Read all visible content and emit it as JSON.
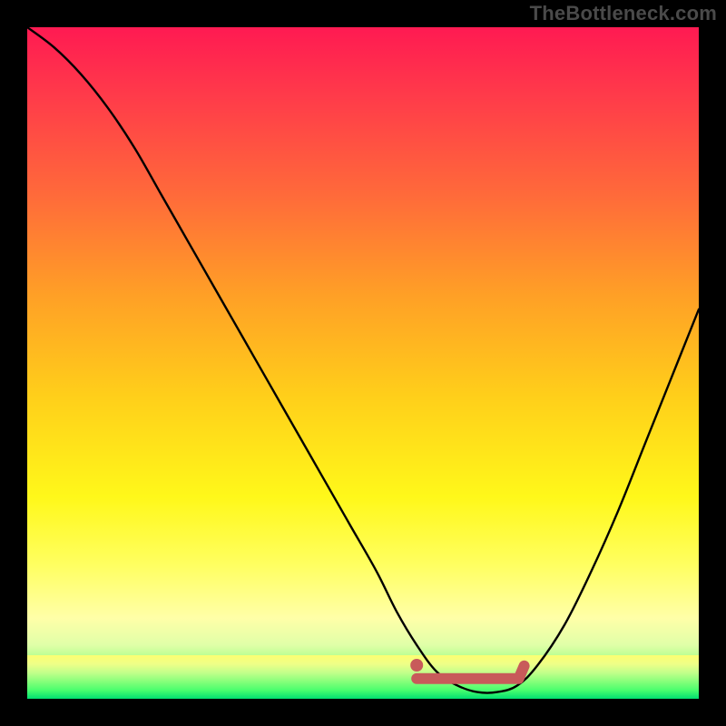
{
  "watermark": "TheBottleneck.com",
  "colors": {
    "frame_bg": "#000000",
    "curve_stroke": "#000000",
    "marker_stroke": "#c85a5a",
    "marker_fill": "#c85a5a",
    "watermark_text": "#4a4a4a"
  },
  "chart_data": {
    "type": "line",
    "title": "",
    "xlabel": "",
    "ylabel": "",
    "xlim": [
      0,
      100
    ],
    "ylim": [
      0,
      100
    ],
    "series": [
      {
        "name": "bottleneck-curve",
        "x": [
          0,
          4,
          8,
          12,
          16,
          20,
          24,
          28,
          32,
          36,
          40,
          44,
          48,
          52,
          55,
          58,
          61,
          64,
          67,
          70,
          73,
          76,
          80,
          84,
          88,
          92,
          96,
          100
        ],
        "values": [
          100,
          97,
          93,
          88,
          82,
          75,
          68,
          61,
          54,
          47,
          40,
          33,
          26,
          19,
          13,
          8,
          4,
          2,
          1,
          1,
          2,
          5,
          11,
          19,
          28,
          38,
          48,
          58
        ]
      }
    ],
    "marker": {
      "name": "optimal-range",
      "x_start": 58,
      "x_end": 74,
      "y": 3,
      "dot_x": 58,
      "dot_y": 5
    },
    "annotations": []
  }
}
